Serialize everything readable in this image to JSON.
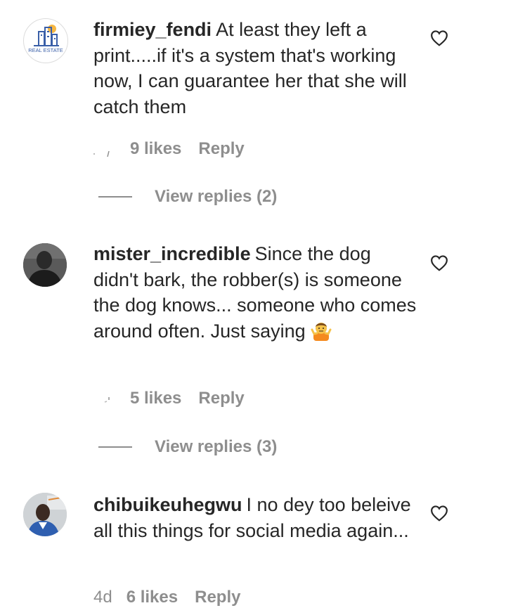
{
  "comments": [
    {
      "username": "firmiey_fendi",
      "text": "At least they left a print.....if it's a system that's working now, I can guarantee her that she will catch them",
      "avatar_icon": "real-estate-logo",
      "avatar_label": "REAL ESTATE",
      "likes": "9 likes",
      "reply": "Reply",
      "view_replies": "View replies (2)"
    },
    {
      "username": "mister_incredible",
      "text": "Since the dog didn't bark, the robber(s) is someone the dog knows... someone who comes around often. Just saying",
      "emoji": "person-shrugging-emoji",
      "avatar_icon": "person-photo",
      "likes": "5 likes",
      "reply": "Reply",
      "view_replies": "View replies (3)"
    },
    {
      "username": "chibuikeuhegwu",
      "text": "I no dey too beleive all this things for social media again...",
      "avatar_icon": "person-photo",
      "time": "4d",
      "likes": "6 likes",
      "reply": "Reply"
    }
  ],
  "icons": {
    "like": "heart-outline-icon"
  },
  "colors": {
    "text": "#262626",
    "secondary": "#8e8e8e",
    "logo_blue": "#3a5fa8",
    "logo_sun": "#f5b642"
  }
}
